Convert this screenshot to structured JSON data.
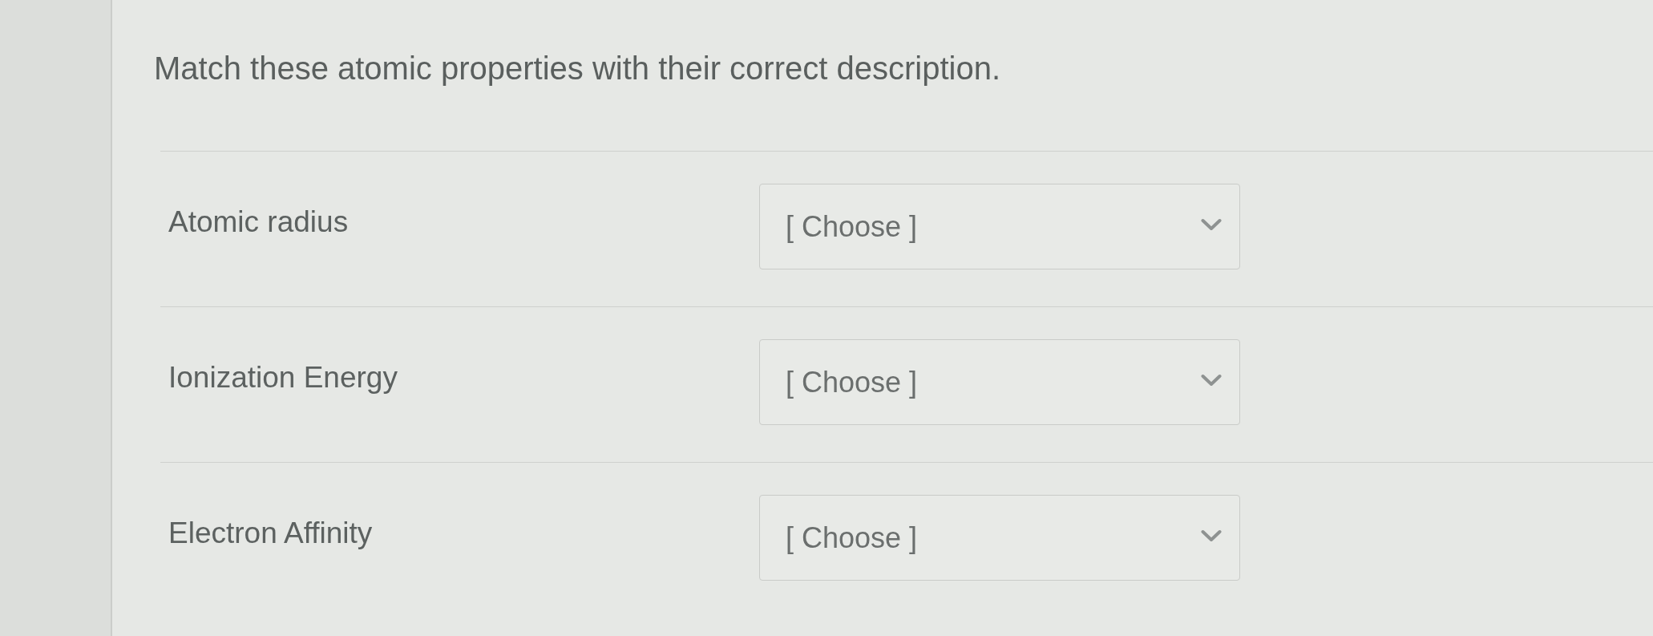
{
  "question": {
    "prompt": "Match these atomic properties with their correct description."
  },
  "matches": [
    {
      "term": "Atomic radius",
      "dropdown": {
        "placeholder": "[ Choose ]"
      }
    },
    {
      "term": "Ionization Energy",
      "dropdown": {
        "placeholder": "[ Choose ]"
      }
    },
    {
      "term": "Electron Affinity",
      "dropdown": {
        "placeholder": "[ Choose ]"
      }
    }
  ]
}
